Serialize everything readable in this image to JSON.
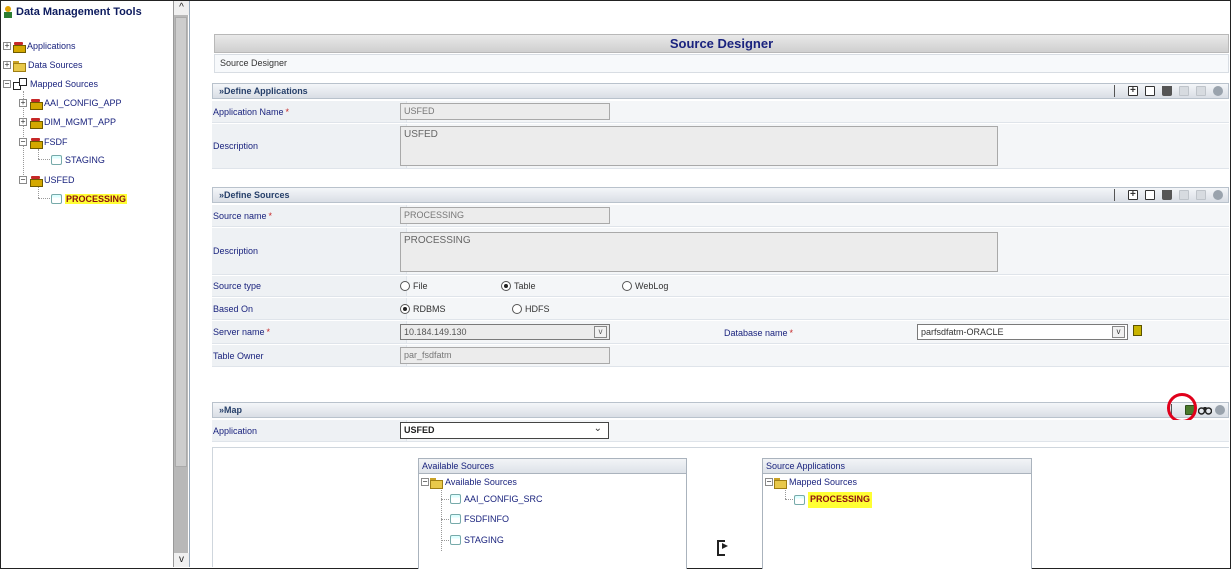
{
  "tree": {
    "root": "Data Management Tools",
    "items": [
      {
        "label": "Applications"
      },
      {
        "label": "Data Sources"
      },
      {
        "label": "Mapped Sources"
      },
      {
        "label": "AAI_CONFIG_APP"
      },
      {
        "label": "DIM_MGMT_APP"
      },
      {
        "label": "FSDF"
      },
      {
        "label": "STAGING"
      },
      {
        "label": "USFED"
      },
      {
        "label": "PROCESSING"
      }
    ]
  },
  "page": {
    "title": "Source Designer",
    "breadcrumb": "Source Designer"
  },
  "define_applications": {
    "header": "Define Applications",
    "application_name_label": "Application Name",
    "application_name": "USFED",
    "description_label": "Description",
    "description": "USFED"
  },
  "define_sources": {
    "header": "Define Sources",
    "source_name_label": "Source name",
    "source_name": "PROCESSING",
    "description_label": "Description",
    "description": "PROCESSING",
    "source_type_label": "Source type",
    "source_type_options": [
      "File",
      "Table",
      "WebLog"
    ],
    "source_type_selected": "Table",
    "based_on_label": "Based On",
    "based_on_options": [
      "RDBMS",
      "HDFS"
    ],
    "based_on_selected": "RDBMS",
    "server_name_label": "Server name",
    "server_name": "10.184.149.130",
    "database_name_label": "Database name",
    "database_name": "parfsdfatm-ORACLE",
    "table_owner_label": "Table Owner",
    "table_owner": "par_fsdfatm"
  },
  "map": {
    "header": "Map",
    "application_label": "Application",
    "application": "USFED",
    "available_sources_title": "Available Sources",
    "available_root": "Available Sources",
    "available_items": [
      "AAI_CONFIG_SRC",
      "FSDFINFO",
      "STAGING"
    ],
    "source_applications_title": "Source Applications",
    "mapped_root": "Mapped Sources",
    "mapped_items": [
      "PROCESSING"
    ]
  },
  "colors": {
    "highlight": "#ffff33",
    "annotation_circle": "#e0001b",
    "title_text": "#1a237e"
  }
}
